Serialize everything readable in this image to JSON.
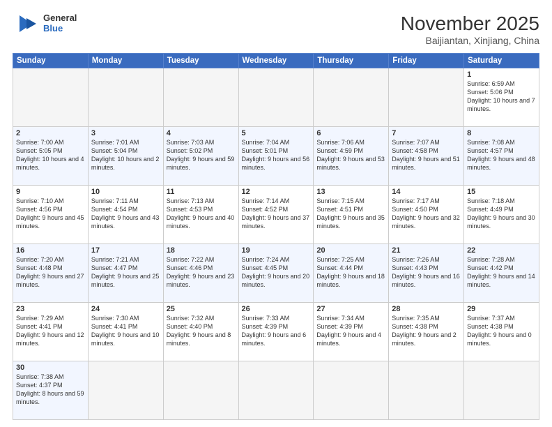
{
  "header": {
    "logo_general": "General",
    "logo_blue": "Blue",
    "month_year": "November 2025",
    "location": "Baijiantan, Xinjiang, China"
  },
  "weekdays": [
    "Sunday",
    "Monday",
    "Tuesday",
    "Wednesday",
    "Thursday",
    "Friday",
    "Saturday"
  ],
  "weeks": [
    [
      {
        "day": "",
        "info": ""
      },
      {
        "day": "",
        "info": ""
      },
      {
        "day": "",
        "info": ""
      },
      {
        "day": "",
        "info": ""
      },
      {
        "day": "",
        "info": ""
      },
      {
        "day": "",
        "info": ""
      },
      {
        "day": "1",
        "info": "Sunrise: 6:59 AM\nSunset: 5:06 PM\nDaylight: 10 hours and 7 minutes."
      }
    ],
    [
      {
        "day": "2",
        "info": "Sunrise: 7:00 AM\nSunset: 5:05 PM\nDaylight: 10 hours and 4 minutes."
      },
      {
        "day": "3",
        "info": "Sunrise: 7:01 AM\nSunset: 5:04 PM\nDaylight: 10 hours and 2 minutes."
      },
      {
        "day": "4",
        "info": "Sunrise: 7:03 AM\nSunset: 5:02 PM\nDaylight: 9 hours and 59 minutes."
      },
      {
        "day": "5",
        "info": "Sunrise: 7:04 AM\nSunset: 5:01 PM\nDaylight: 9 hours and 56 minutes."
      },
      {
        "day": "6",
        "info": "Sunrise: 7:06 AM\nSunset: 4:59 PM\nDaylight: 9 hours and 53 minutes."
      },
      {
        "day": "7",
        "info": "Sunrise: 7:07 AM\nSunset: 4:58 PM\nDaylight: 9 hours and 51 minutes."
      },
      {
        "day": "8",
        "info": "Sunrise: 7:08 AM\nSunset: 4:57 PM\nDaylight: 9 hours and 48 minutes."
      }
    ],
    [
      {
        "day": "9",
        "info": "Sunrise: 7:10 AM\nSunset: 4:56 PM\nDaylight: 9 hours and 45 minutes."
      },
      {
        "day": "10",
        "info": "Sunrise: 7:11 AM\nSunset: 4:54 PM\nDaylight: 9 hours and 43 minutes."
      },
      {
        "day": "11",
        "info": "Sunrise: 7:13 AM\nSunset: 4:53 PM\nDaylight: 9 hours and 40 minutes."
      },
      {
        "day": "12",
        "info": "Sunrise: 7:14 AM\nSunset: 4:52 PM\nDaylight: 9 hours and 37 minutes."
      },
      {
        "day": "13",
        "info": "Sunrise: 7:15 AM\nSunset: 4:51 PM\nDaylight: 9 hours and 35 minutes."
      },
      {
        "day": "14",
        "info": "Sunrise: 7:17 AM\nSunset: 4:50 PM\nDaylight: 9 hours and 32 minutes."
      },
      {
        "day": "15",
        "info": "Sunrise: 7:18 AM\nSunset: 4:49 PM\nDaylight: 9 hours and 30 minutes."
      }
    ],
    [
      {
        "day": "16",
        "info": "Sunrise: 7:20 AM\nSunset: 4:48 PM\nDaylight: 9 hours and 27 minutes."
      },
      {
        "day": "17",
        "info": "Sunrise: 7:21 AM\nSunset: 4:47 PM\nDaylight: 9 hours and 25 minutes."
      },
      {
        "day": "18",
        "info": "Sunrise: 7:22 AM\nSunset: 4:46 PM\nDaylight: 9 hours and 23 minutes."
      },
      {
        "day": "19",
        "info": "Sunrise: 7:24 AM\nSunset: 4:45 PM\nDaylight: 9 hours and 20 minutes."
      },
      {
        "day": "20",
        "info": "Sunrise: 7:25 AM\nSunset: 4:44 PM\nDaylight: 9 hours and 18 minutes."
      },
      {
        "day": "21",
        "info": "Sunrise: 7:26 AM\nSunset: 4:43 PM\nDaylight: 9 hours and 16 minutes."
      },
      {
        "day": "22",
        "info": "Sunrise: 7:28 AM\nSunset: 4:42 PM\nDaylight: 9 hours and 14 minutes."
      }
    ],
    [
      {
        "day": "23",
        "info": "Sunrise: 7:29 AM\nSunset: 4:41 PM\nDaylight: 9 hours and 12 minutes."
      },
      {
        "day": "24",
        "info": "Sunrise: 7:30 AM\nSunset: 4:41 PM\nDaylight: 9 hours and 10 minutes."
      },
      {
        "day": "25",
        "info": "Sunrise: 7:32 AM\nSunset: 4:40 PM\nDaylight: 9 hours and 8 minutes."
      },
      {
        "day": "26",
        "info": "Sunrise: 7:33 AM\nSunset: 4:39 PM\nDaylight: 9 hours and 6 minutes."
      },
      {
        "day": "27",
        "info": "Sunrise: 7:34 AM\nSunset: 4:39 PM\nDaylight: 9 hours and 4 minutes."
      },
      {
        "day": "28",
        "info": "Sunrise: 7:35 AM\nSunset: 4:38 PM\nDaylight: 9 hours and 2 minutes."
      },
      {
        "day": "29",
        "info": "Sunrise: 7:37 AM\nSunset: 4:38 PM\nDaylight: 9 hours and 0 minutes."
      }
    ],
    [
      {
        "day": "30",
        "info": "Sunrise: 7:38 AM\nSunset: 4:37 PM\nDaylight: 8 hours and 59 minutes."
      },
      {
        "day": "",
        "info": ""
      },
      {
        "day": "",
        "info": ""
      },
      {
        "day": "",
        "info": ""
      },
      {
        "day": "",
        "info": ""
      },
      {
        "day": "",
        "info": ""
      },
      {
        "day": "",
        "info": ""
      }
    ]
  ]
}
